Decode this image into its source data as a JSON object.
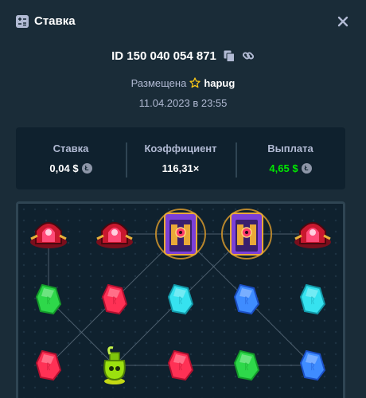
{
  "header": {
    "title": "Ставка",
    "icon": "bet-slip-icon",
    "close_icon": "close-icon"
  },
  "bet": {
    "id": "ID 150 040 054 871",
    "copy_icon": "copy-icon",
    "link_icon": "link-icon",
    "placed_label": "Размещена",
    "username": "hapug",
    "vip_icon": "star-icon",
    "datetime": "11.04.2023 в 23:55"
  },
  "stats": {
    "bet_label": "Ставка",
    "bet_value": "0,04 $",
    "multiplier_label": "Коэффициент",
    "multiplier_value": "116,31×",
    "payout_label": "Выплата",
    "payout_value": "4,65 $",
    "currency_icon": "litecoin-icon"
  },
  "colors": {
    "background": "#1a2c38",
    "panel": "#0f212e",
    "muted": "#b1bad3",
    "win": "#00e701"
  },
  "board": {
    "rows": [
      [
        "red-tower",
        "red-tower",
        "purple-gate",
        "purple-gate",
        "red-tower"
      ],
      [
        "green-gem",
        "red-gem",
        "cyan-gem",
        "blue-gem",
        "cyan-gem"
      ],
      [
        "red-gem",
        "green-potion",
        "red-gem",
        "green-gem",
        "blue-gem"
      ]
    ]
  }
}
